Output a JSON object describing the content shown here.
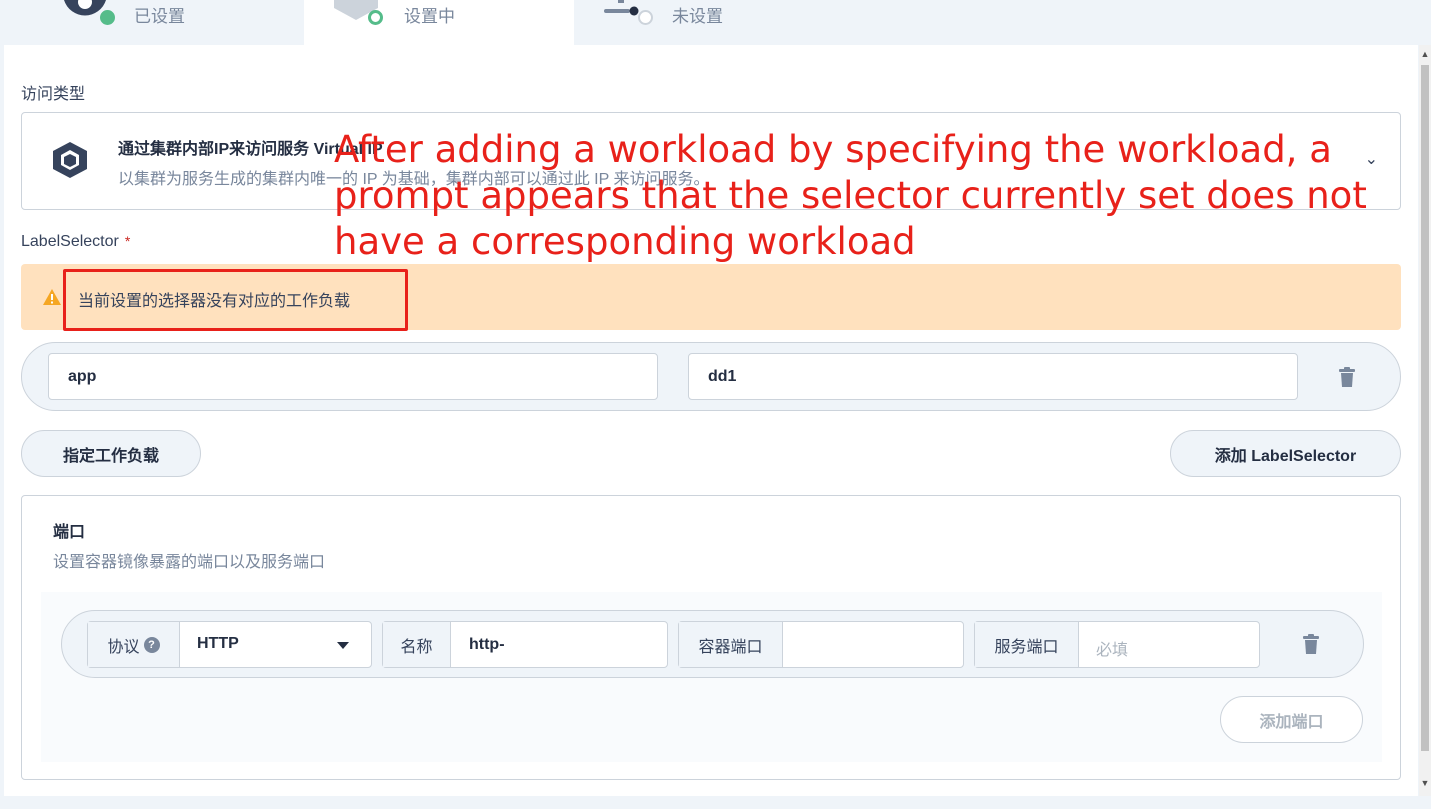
{
  "steps": [
    {
      "label": "已设置",
      "state": "done",
      "dot_color": "#55bc8a"
    },
    {
      "label": "设置中",
      "state": "active",
      "dot_color": "#55bc8a"
    },
    {
      "label": "未设置",
      "state": "pending",
      "dot_color": "#ccd3db"
    }
  ],
  "access": {
    "label": "访问类型",
    "title": "通过集群内部IP来访问服务 Virtual IP",
    "description": "以集群为服务生成的集群内唯一的 IP 为基础，集群内部可以通过此 IP 来访问服务。",
    "icon": "cube-icon",
    "chevron": "chevron-down-icon"
  },
  "label_selector": {
    "label": "LabelSelector",
    "required_mark": "*",
    "warning": "当前设置的选择器没有对应的工作负载",
    "key": "app",
    "value": "dd1"
  },
  "buttons": {
    "specify_workload": "指定工作负载",
    "add_label_selector": "添加 LabelSelector",
    "add_port": "添加端口"
  },
  "ports": {
    "title": "端口",
    "description": "设置容器镜像暴露的端口以及服务端口",
    "protocol_label": "协议",
    "protocol_help": "?",
    "protocol_value": "HTTP",
    "name_label": "名称",
    "name_value": "http-",
    "container_port_label": "容器端口",
    "container_port_value": "",
    "service_port_label": "服务端口",
    "service_port_placeholder": "必填"
  },
  "annotation": "After adding a workload by specifying the workload, a prompt appears that the selector currently set does not have a corresponding workload",
  "colors": {
    "warning_bg": "#ffe1be",
    "annotation_red": "#e8211a",
    "success_green": "#55bc8a"
  }
}
